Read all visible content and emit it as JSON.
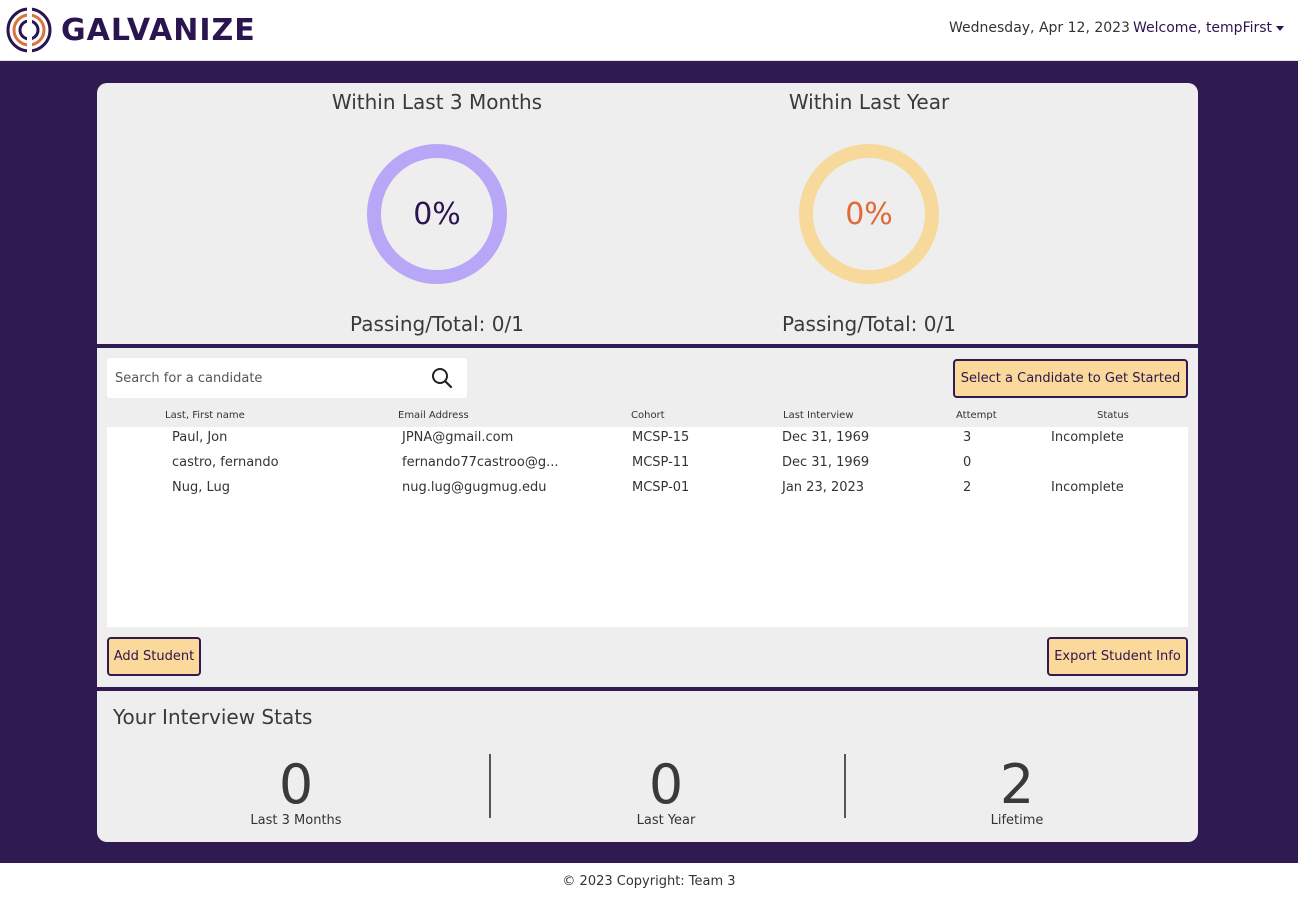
{
  "header": {
    "brand": "GALVANIZE",
    "date": "Wednesday, Apr 12, 2023",
    "welcome": "Welcome, tempFirst"
  },
  "summary": {
    "recent": {
      "title": "Within Last 3 Months",
      "percent": "0%",
      "passing": "Passing/Total: 0/1"
    },
    "year": {
      "title": "Within Last Year",
      "percent": "0%",
      "passing": "Passing/Total: 0/1"
    }
  },
  "candidates": {
    "search_placeholder": "Search for a candidate",
    "select_button": "Select a Candidate to Get Started",
    "columns": [
      "Last, First name",
      "Email Address",
      "Cohort",
      "Last Interview",
      "Attempt",
      "Status"
    ],
    "rows": [
      {
        "name": "Paul, Jon",
        "email": "JPNA@gmail.com",
        "cohort": "MCSP-15",
        "last_interview": "Dec 31, 1969",
        "attempt": "3",
        "status": "Incomplete"
      },
      {
        "name": "castro, fernando",
        "email": "fernando77castroo@g...",
        "cohort": "MCSP-11",
        "last_interview": "Dec 31, 1969",
        "attempt": "0",
        "status": ""
      },
      {
        "name": "Nug, Lug",
        "email": "nug.lug@gugmug.edu",
        "cohort": "MCSP-01",
        "last_interview": "Jan 23, 2023",
        "attempt": "2",
        "status": "Incomplete"
      }
    ],
    "add_button": "Add Student",
    "export_button": "Export Student Info"
  },
  "stats": {
    "title": "Your Interview Stats",
    "items": [
      {
        "value": "0",
        "label": "Last 3 Months"
      },
      {
        "value": "0",
        "label": "Last Year"
      },
      {
        "value": "2",
        "label": "Lifetime"
      }
    ]
  },
  "footer": {
    "copyright": "© 2023 Copyright: Team 3"
  },
  "colors": {
    "brand_purple": "#301a52",
    "ring_recent": "#b8a6f7",
    "ring_year": "#f7d99c",
    "percent_recent": "#2b1550",
    "percent_year": "#e06a3a",
    "button_fill": "#fbd99a"
  }
}
